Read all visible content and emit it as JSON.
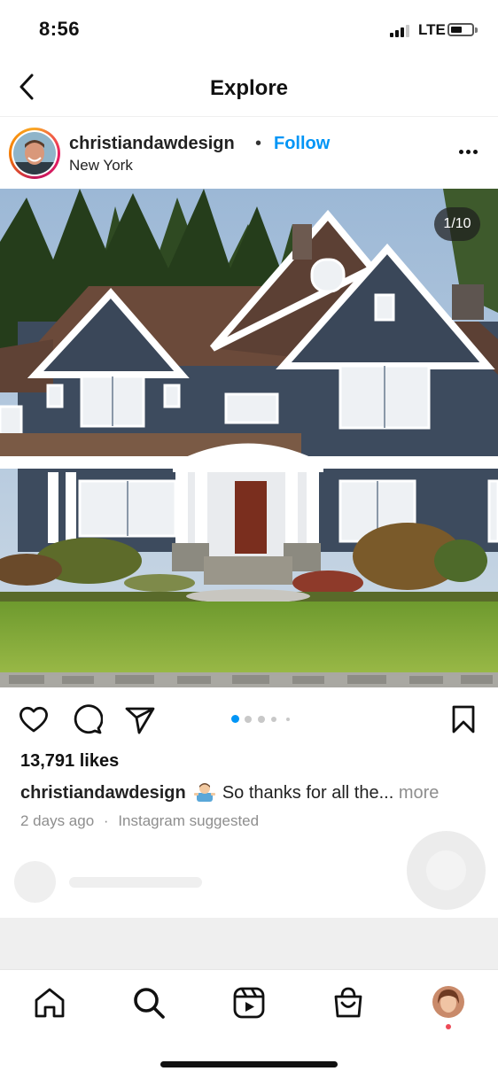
{
  "status_bar": {
    "time": "8:56",
    "network": "LTE",
    "signal_bars": 3,
    "battery_level": 0.4
  },
  "nav": {
    "title": "Explore",
    "back_icon": "chevron-left-icon"
  },
  "post": {
    "username": "christiandawdesign",
    "separator": "•",
    "follow_label": "Follow",
    "location": "New York",
    "menu_icon": "more-horizontal-icon",
    "image_counter": "1/10",
    "carousel_dots": 5,
    "active_dot": 0,
    "likes": "13,791 likes",
    "caption_user": "christiandawdesign",
    "caption_text": "So thanks for all the...",
    "caption_more": "more",
    "time_ago": "2 days ago",
    "meta_sep": "·",
    "suggested": "Instagram suggested"
  },
  "actions": [
    "heart-icon",
    "comment-icon",
    "share-icon",
    "bookmark-icon"
  ],
  "tabbar": [
    "home-icon",
    "search-icon",
    "reels-icon",
    "shop-icon",
    "profile-icon"
  ],
  "colors": {
    "accent": "#0095f6",
    "notification": "#ed4956",
    "muted": "#8e8e8e"
  }
}
